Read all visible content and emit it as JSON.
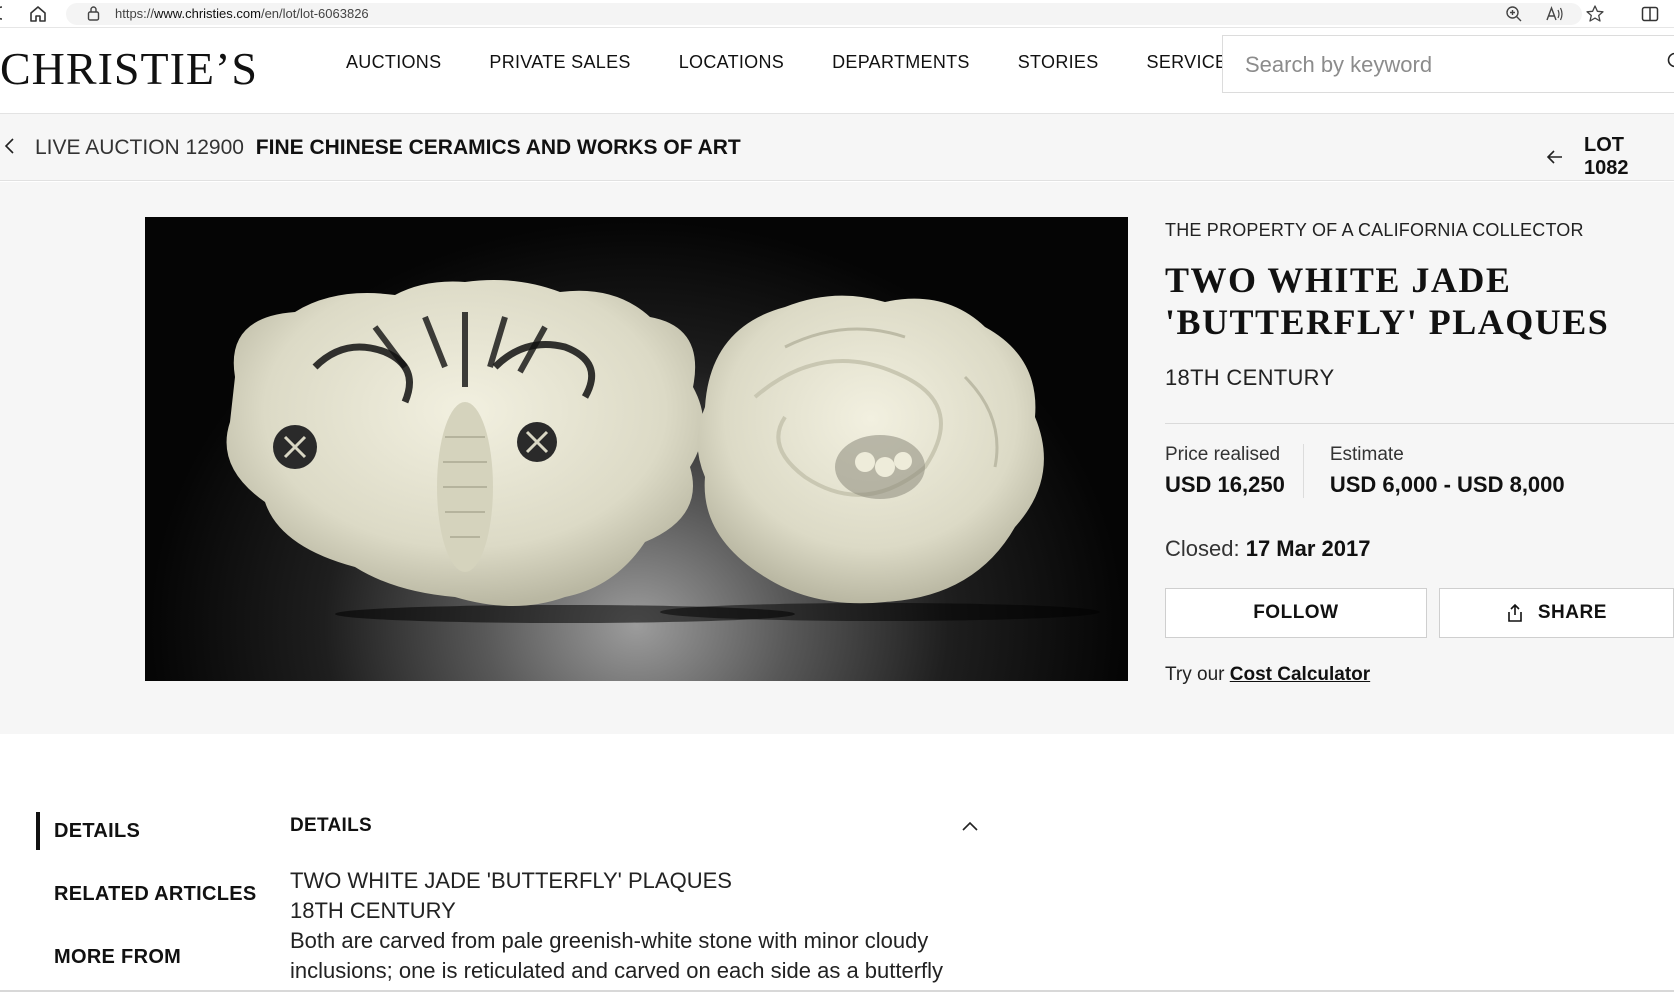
{
  "browser": {
    "url_prefix": "https://",
    "url_domain": "www.christies.com",
    "url_path": "/en/lot/lot-6063826"
  },
  "header": {
    "logo": "CHRISTIE’S",
    "nav": [
      "AUCTIONS",
      "PRIVATE SALES",
      "LOCATIONS",
      "DEPARTMENTS",
      "STORIES",
      "SERVICES"
    ],
    "search_placeholder": "Search by keyword"
  },
  "breadcrumb": {
    "sale": "LIVE AUCTION 12900",
    "title": "FINE CHINESE CERAMICS AND WORKS OF ART",
    "lot": "LOT 1082"
  },
  "lot": {
    "provenance": "THE PROPERTY OF A CALIFORNIA COLLECTOR",
    "title_line1": "TWO WHITE JADE",
    "title_line2": "'BUTTERFLY' PLAQUES",
    "subtitle": "18TH CENTURY",
    "price_label": "Price realised",
    "price_value": "USD 16,250",
    "estimate_label": "Estimate",
    "estimate_value": "USD 6,000 - USD 8,000",
    "closed_label": "Closed:",
    "closed_date": "17 Mar 2017",
    "follow_label": "FOLLOW",
    "share_label": "SHARE",
    "cost_prefix": "Try our",
    "cost_link": "Cost Calculator"
  },
  "side_nav": [
    "DETAILS",
    "RELATED ARTICLES",
    "MORE FROM"
  ],
  "details": {
    "heading": "DETAILS",
    "lines": [
      "TWO WHITE JADE 'BUTTERFLY' PLAQUES",
      "18TH CENTURY",
      "Both are carved from pale greenish-white stone with minor cloudy",
      "inclusions; one is reticulated and carved on each side as a butterfly"
    ]
  },
  "icons": {
    "home": "home-icon",
    "lock": "lock-icon",
    "zoom": "zoom-in-icon",
    "read_aloud": "read-aloud-icon",
    "favorite": "star-icon",
    "split": "split-screen-icon",
    "search": "search-icon",
    "back": "chevron-left-icon",
    "prev_lot": "arrow-left-icon",
    "share": "share-icon",
    "collapse": "chevron-up-icon"
  }
}
